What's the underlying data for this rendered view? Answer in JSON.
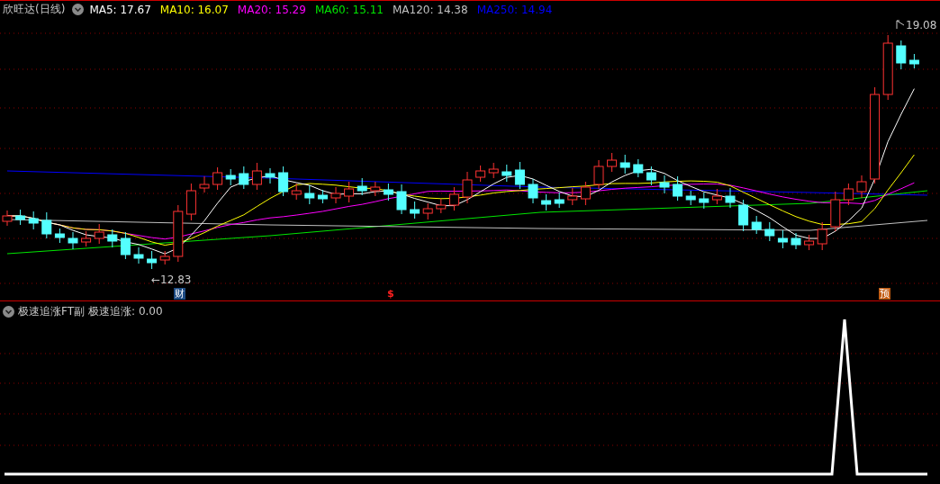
{
  "header": {
    "title": "欣旺达(日线)",
    "moving_averages": [
      {
        "label": "MA5: 17.67",
        "color": "#ffffff"
      },
      {
        "label": "MA10: 16.07",
        "color": "#ffff00"
      },
      {
        "label": "MA20: 15.29",
        "color": "#ff00ff"
      },
      {
        "label": "MA60: 15.11",
        "color": "#00e600"
      },
      {
        "label": "MA120: 14.38",
        "color": "#c0c0c0"
      },
      {
        "label": "MA250: 14.94",
        "color": "#0000ff"
      }
    ]
  },
  "price_chart": {
    "high_label": "19.08",
    "low_label": "←12.83",
    "markers": [
      {
        "kind": "finance",
        "text": "财"
      },
      {
        "kind": "dollar",
        "text": "$"
      },
      {
        "kind": "forecast",
        "text": "预"
      }
    ]
  },
  "indicator": {
    "title": "极速追涨FT副",
    "reading": "极速追涨: 0.00"
  }
}
